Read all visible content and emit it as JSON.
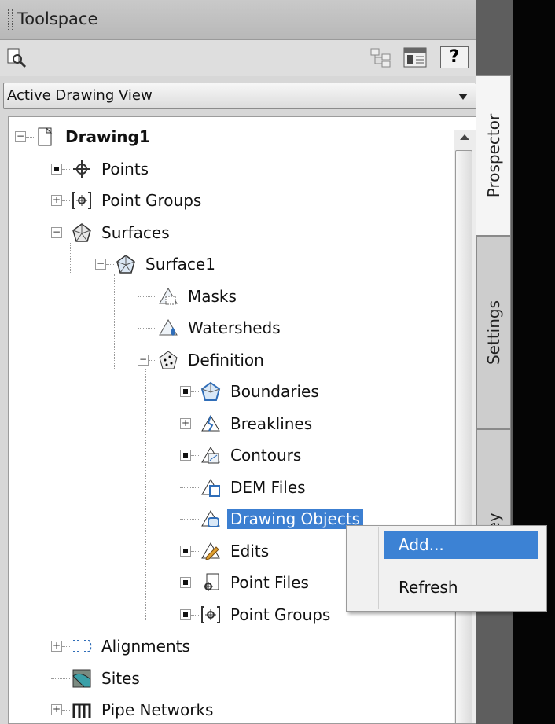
{
  "window": {
    "title": "Toolspace"
  },
  "view_selector": {
    "value": "Active Drawing View"
  },
  "tabs": [
    {
      "label": "Prospector",
      "active": true
    },
    {
      "label": "Settings",
      "active": false
    },
    {
      "label": "Survey",
      "active": false
    }
  ],
  "tree": [
    {
      "label": "Drawing1",
      "icon": "drawing-icon",
      "expander": "minus",
      "bold": true
    },
    {
      "label": "Points",
      "icon": "points-icon",
      "expander": "dot"
    },
    {
      "label": "Point Groups",
      "icon": "point-groups-icon",
      "expander": "plus"
    },
    {
      "label": "Surfaces",
      "icon": "surfaces-icon",
      "expander": "minus"
    },
    {
      "label": "Surface1",
      "icon": "surface-icon",
      "expander": "minus"
    },
    {
      "label": "Masks",
      "icon": "masks-icon",
      "expander": "none"
    },
    {
      "label": "Watersheds",
      "icon": "watersheds-icon",
      "expander": "none"
    },
    {
      "label": "Definition",
      "icon": "definition-icon",
      "expander": "minus"
    },
    {
      "label": "Boundaries",
      "icon": "boundaries-icon",
      "expander": "dot"
    },
    {
      "label": "Breaklines",
      "icon": "breaklines-icon",
      "expander": "plus"
    },
    {
      "label": "Contours",
      "icon": "contours-icon",
      "expander": "dot"
    },
    {
      "label": "DEM Files",
      "icon": "dem-files-icon",
      "expander": "none"
    },
    {
      "label": "Drawing Objects",
      "icon": "drawing-objects-icon",
      "expander": "none",
      "selected": true
    },
    {
      "label": "Edits",
      "icon": "edits-icon",
      "expander": "dot"
    },
    {
      "label": "Point Files",
      "icon": "point-files-icon",
      "expander": "dot"
    },
    {
      "label": "Point Groups",
      "icon": "point-groups-icon",
      "expander": "dot"
    },
    {
      "label": "Alignments",
      "icon": "alignments-icon",
      "expander": "plus"
    },
    {
      "label": "Sites",
      "icon": "sites-icon",
      "expander": "none"
    },
    {
      "label": "Pipe Networks",
      "icon": "pipe-networks-icon",
      "expander": "plus"
    }
  ],
  "context_menu": {
    "items": [
      "Add...",
      "Refresh"
    ],
    "highlighted": "Add..."
  },
  "colors": {
    "selection": "#3c7fd1",
    "menu_highlight": "#3c82d4",
    "icon_blue": "#2f6db8"
  }
}
